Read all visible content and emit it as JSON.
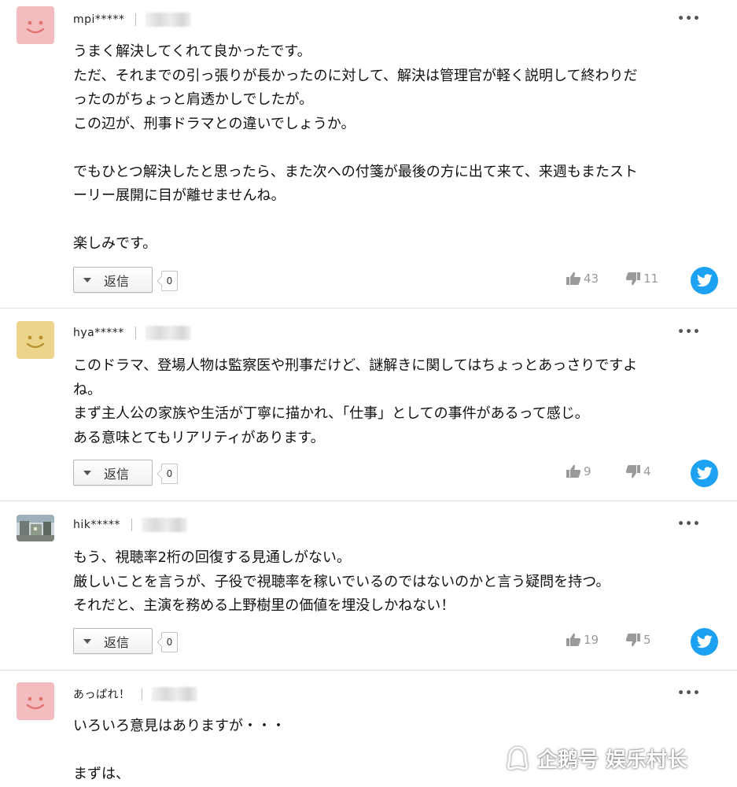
{
  "colors": {
    "twitter_blue": "#1da1f2",
    "avatar_pink": "#f3bcbf",
    "avatar_yellow": "#ecd58a",
    "vote_gray": "#9a9a9a"
  },
  "comments": [
    {
      "username": "mpi*****",
      "avatar": "pink-smiley-avatar",
      "menu": "•••",
      "lines": [
        "うまく解決してくれて良かったです。",
        "ただ、それまでの引っ張りが長かったのに対して、解決は管理官が軽く説明して終わりだ",
        "ったのがちょっと肩透かしでしたが。",
        "この辺が、刑事ドラマとの違いでしょうか。",
        "",
        "でもひとつ解決したと思ったら、また次への付箋が最後の方に出て来て、来週もまたスト",
        "ーリー展開に目が離せませんね。",
        "",
        "楽しみです。"
      ],
      "reply_label": "返信",
      "reply_count": "0",
      "likes": "43",
      "dislikes": "11"
    },
    {
      "username": "hya*****",
      "avatar": "yellow-smiley-avatar",
      "menu": "•••",
      "lines": [
        "このドラマ、登場人物は監察医や刑事だけど、謎解きに関してはちょっとあっさりですよ",
        "ね。",
        "まず主人公の家族や生活が丁寧に描かれ、「仕事」としての事件があるって感じ。",
        "ある意味とてもリアリティがあります。"
      ],
      "reply_label": "返信",
      "reply_count": "0",
      "likes": "9",
      "dislikes": "4"
    },
    {
      "username": "hik*****",
      "avatar": "photo-avatar",
      "menu": "•••",
      "lines": [
        "もう、視聴率2桁の回復する見通しがない。",
        "厳しいことを言うが、子役で視聴率を稼いでいるのではないのかと言う疑問を持つ。",
        "それだと、主演を務める上野樹里の価値を埋没しかねない！"
      ],
      "reply_label": "返信",
      "reply_count": "0",
      "likes": "19",
      "dislikes": "5"
    },
    {
      "username": "あっぱれ！",
      "avatar": "pink-smiley-avatar",
      "menu": "•••",
      "lines": [
        "いろいろ意見はありますが・・・",
        "",
        "まずは、"
      ]
    }
  ],
  "watermark": {
    "text": "企鹅号 娱乐村长",
    "icon": "penguin-logo-icon"
  }
}
